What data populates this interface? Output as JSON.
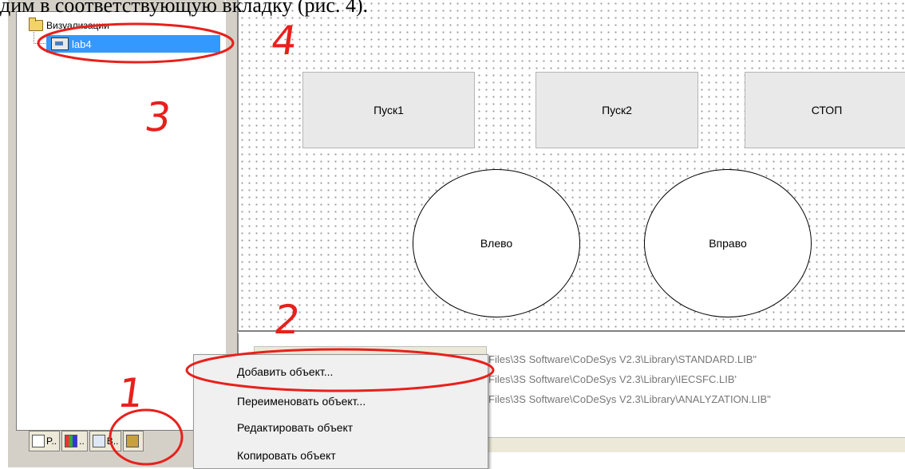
{
  "caption": "дим в соответствующую вкладку (рис. 4).",
  "tree": {
    "root_label": "Визуализации",
    "item_label": "lab4"
  },
  "tabs": [
    {
      "label": "P..",
      "icon": "pou-icon"
    },
    {
      "label": "..",
      "icon": "datatypes-icon"
    },
    {
      "label": "B..",
      "icon": "visualization-icon"
    },
    {
      "label": "",
      "icon": "resources-icon"
    }
  ],
  "canvas": {
    "buttons": [
      "Пуск1",
      "Пуск2",
      "СТОП"
    ],
    "ellipses": [
      "Влево",
      "Вправо"
    ]
  },
  "libraries": [
    "Files\\3S Software\\CoDeSys V2.3\\Library\\STANDARD.LIB\"",
    "Files\\3S Software\\CoDeSys V2.3\\Library\\IECSFC.LIB'",
    "Files\\3S Software\\CoDeSys V2.3\\Library\\ANALYZATION.LIB\""
  ],
  "context_menu": [
    "Добавить объект...",
    "Переименовать объект...",
    "Редактировать объект",
    "Копировать объект"
  ],
  "annotations": [
    "1",
    "2",
    "3",
    "4"
  ],
  "colors": {
    "annotation": "#e8201c",
    "selection": "#3399ff"
  }
}
